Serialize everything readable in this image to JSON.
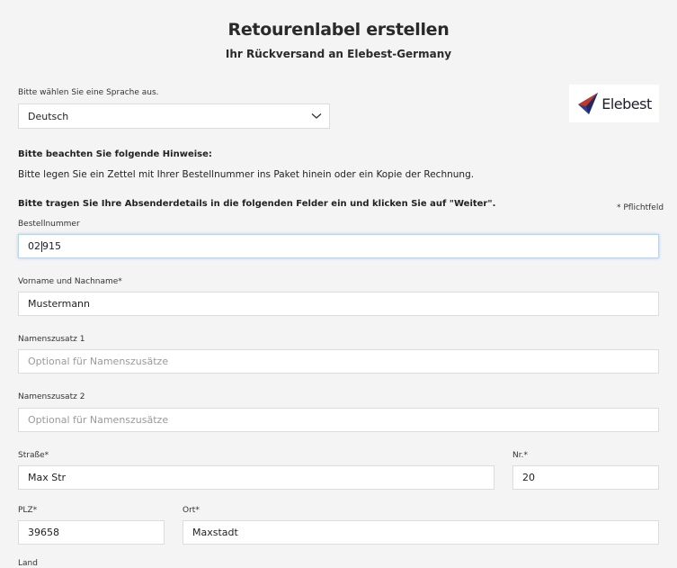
{
  "header": {
    "title": "Retourenlabel erstellen",
    "subtitle": "Ihr Rückversand an Elebest-Germany"
  },
  "language": {
    "label": "Bitte wählen Sie eine Sprache aus.",
    "selected": "Deutsch"
  },
  "logo": {
    "text": "Elebest"
  },
  "hints": {
    "heading": "Bitte beachten Sie folgende Hinweise:",
    "body": "Bitte legen Sie ein Zettel mit Ihrer Bestellnummer ins Paket hinein oder ein Kopie der Rechnung.",
    "instruction": "Bitte tragen Sie Ihre Absenderdetails in die folgenden Felder ein und klicken Sie auf \"Weiter\".",
    "required_note": "* Pflichtfeld"
  },
  "form": {
    "order_number": {
      "label": "Bestellnummer",
      "value_before_caret": "02",
      "value_after_caret": "915"
    },
    "name": {
      "label": "Vorname und Nachname*",
      "value": "Mustermann"
    },
    "name_suffix_1": {
      "label": "Namenszusatz 1",
      "placeholder": "Optional für Namenszusätze"
    },
    "name_suffix_2": {
      "label": "Namenszusatz 2",
      "placeholder": "Optional für Namenszusätze"
    },
    "street": {
      "label": "Straße*",
      "value": "Max Str"
    },
    "house_number": {
      "label": "Nr.*",
      "value": "20"
    },
    "zip": {
      "label": "PLZ*",
      "value": "39658"
    },
    "city": {
      "label": "Ort*",
      "value": "Maxstadt"
    },
    "country": {
      "label": "Land"
    }
  },
  "colors": {
    "background": "#f4f4f4",
    "field_border": "#dcdcdc",
    "focus_border": "#bcd3ea",
    "logo_accent": "#c0392b",
    "logo_blue": "#2c3e8f"
  }
}
